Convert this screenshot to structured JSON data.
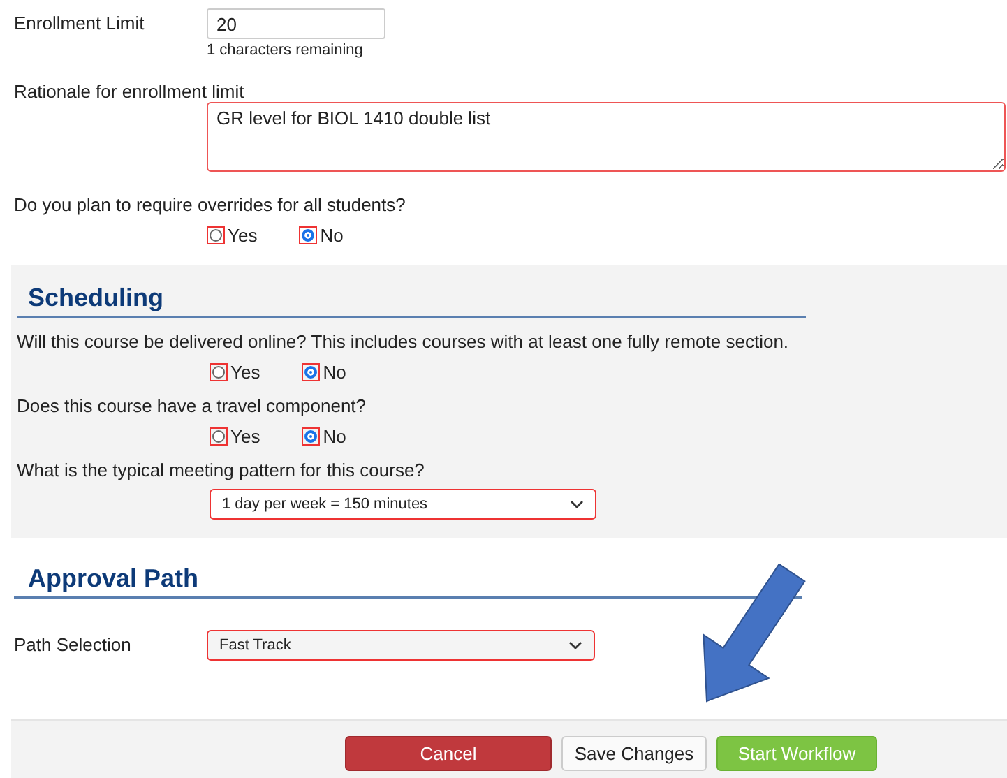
{
  "enrollment_limit": {
    "label": "Enrollment Limit",
    "value": "20",
    "hint": "1 characters remaining"
  },
  "rationale": {
    "label": "Rationale for enrollment limit",
    "value": "GR level for BIOL 1410 double list"
  },
  "overrides": {
    "question": "Do you plan to require overrides for all students?",
    "options": [
      {
        "label": "Yes",
        "selected": false
      },
      {
        "label": "No",
        "selected": true
      }
    ]
  },
  "scheduling": {
    "title": "Scheduling",
    "questions": [
      {
        "kind": "radio",
        "question": "Will this course be delivered online? This includes courses with at least one fully remote section.",
        "options": [
          {
            "label": "Yes",
            "selected": false
          },
          {
            "label": "No",
            "selected": true
          }
        ]
      },
      {
        "kind": "radio",
        "question": "Does this course have a travel component?",
        "options": [
          {
            "label": "Yes",
            "selected": false
          },
          {
            "label": "No",
            "selected": true
          }
        ]
      },
      {
        "kind": "select",
        "question": "What is the typical meeting pattern for this course?",
        "value": "1 day per week = 150 minutes"
      }
    ]
  },
  "approval_path": {
    "title": "Approval Path",
    "label": "Path Selection",
    "value": "Fast Track"
  },
  "buttons": [
    {
      "label": "Cancel",
      "kind": "danger"
    },
    {
      "label": "Save Changes",
      "kind": "default"
    },
    {
      "label": "Start Workflow",
      "kind": "success"
    }
  ]
}
